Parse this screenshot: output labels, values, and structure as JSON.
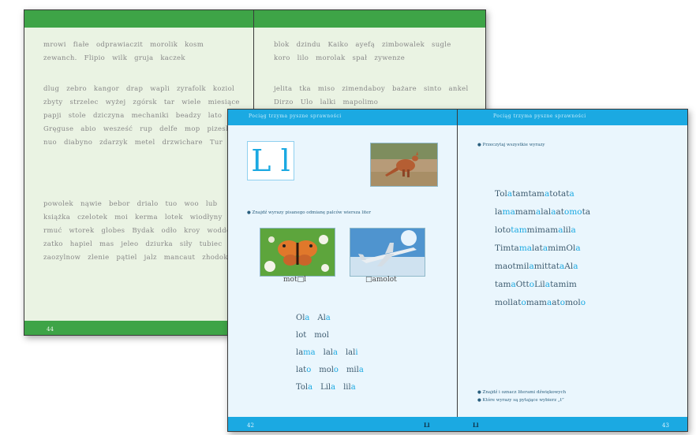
{
  "back_book": {
    "page_number": "44",
    "paragraphs_left": [
      [
        "mrowi",
        "fiałe",
        "odprawiaczit",
        "morolik",
        "kosm",
        "zewanch.",
        "Flipio",
        "wilk",
        "gruja",
        "kaczek"
      ],
      [
        "dlug",
        "zebro",
        "kangor",
        "drap",
        "wapli",
        "zyrafolk",
        "koziol",
        "zbyty",
        "strzelec",
        "wyżej",
        "zgórsk",
        "tar",
        "wiele",
        "miesiące",
        "papji",
        "stole",
        "dziczyna",
        "mechaniki",
        "beadzy",
        "lato",
        "Gręguse",
        "abio",
        "wesześć",
        "rup",
        "delfe",
        "mop",
        "pizeski",
        "nuo",
        "diabyno",
        "zdarzyk",
        "metel",
        "drzwichare",
        "Tur"
      ],
      [
        "powolek",
        "nąwie",
        "bebor",
        "drialo",
        "tuo",
        "woo",
        "lub",
        "książka",
        "czelotek",
        "moi",
        "kerma",
        "lotek",
        "wiodłyny",
        "rmuć",
        "wtorek",
        "globes",
        "Bydak",
        "odło",
        "kroy",
        "woddek",
        "zatko",
        "hapiel",
        "mas",
        "jeleo",
        "dziurka",
        "siły",
        "tubiec",
        "zaozylnow",
        "zlenie",
        "pątiel",
        "jalz",
        "mancaut",
        "zhodok"
      ]
    ],
    "paragraphs_right": [
      [
        "blok",
        "dzindu",
        "Kaiko",
        "ayefą",
        "zimbowalek",
        "sugle",
        "koro",
        "lilo",
        "morolak",
        "spał",
        "zywenze"
      ],
      [
        "jelita",
        "tka",
        "miso",
        "zimendaboy",
        "bażare",
        "sinto",
        "ankel",
        "Dirzo",
        "Ulo",
        "lalki",
        "mapolimo"
      ]
    ]
  },
  "front_book": {
    "header_text": "Pociąg trzyma pyszne sprawności",
    "letter_heading": "L l",
    "left_page_instruction": "● Znajdź wyrazy pisanego odmianę palców wiersza liter",
    "picture_captions": [
      "mot□l",
      "□amolot"
    ],
    "word_columns": [
      [
        {
          "t": "Ol",
          "h": "a"
        },
        {
          "t": "Al",
          "h": "a"
        }
      ],
      [
        {
          "t": "lot",
          "h": ""
        },
        {
          "t": "mol",
          "h": ""
        }
      ],
      [
        {
          "t": "la",
          "h": "ma"
        },
        {
          "t": "lal",
          "h": "a"
        },
        {
          "t": "lal",
          "h": "i"
        }
      ],
      [
        {
          "t": "lat",
          "h": "o"
        },
        {
          "t": "mol",
          "h": "o"
        },
        {
          "t": "mil",
          "h": "a"
        }
      ],
      [
        {
          "t": "Tol",
          "h": "a"
        },
        {
          "t": "Lil",
          "h": "a"
        },
        {
          "t": "lil",
          "h": "a"
        }
      ]
    ],
    "right_page_instruction": "● Przeczytaj wszystkie wyrazy",
    "reading_lines": [
      [
        {
          "t": "Tol",
          "h": "a"
        },
        {
          "t": "tam",
          "h": ""
        },
        {
          "t": "tam",
          "h": "a"
        },
        {
          "t": "to",
          "h": ""
        },
        {
          "t": "tat",
          "h": "a"
        }
      ],
      [
        {
          "t": "la",
          "h": "ma"
        },
        {
          "t": "mam",
          "h": "a"
        },
        {
          "t": "lal",
          "h": "a"
        },
        {
          "t": "at",
          "h": "omo"
        },
        {
          "t": "ta",
          "h": ""
        }
      ],
      [
        {
          "t": "lot",
          "h": ""
        },
        {
          "t": "o",
          "h": "tam"
        },
        {
          "t": "mi",
          "h": ""
        },
        {
          "t": "mam",
          "h": "a"
        },
        {
          "t": "lil",
          "h": "a"
        }
      ],
      [
        {
          "t": "Tim",
          "h": ""
        },
        {
          "t": "ta",
          "h": "ma"
        },
        {
          "t": "lat",
          "h": "a"
        },
        {
          "t": "mim",
          "h": ""
        },
        {
          "t": "Ol",
          "h": "a"
        }
      ],
      [
        {
          "t": "ma",
          "h": ""
        },
        {
          "t": "ot",
          "h": ""
        },
        {
          "t": "mil",
          "h": "a"
        },
        {
          "t": "mit",
          "h": ""
        },
        {
          "t": "tat",
          "h": "a"
        },
        {
          "t": "Al",
          "h": "a"
        }
      ],
      [
        {
          "t": "tam",
          "h": "a"
        },
        {
          "t": "Ott",
          "h": "o"
        },
        {
          "t": "Lil",
          "h": "a"
        },
        {
          "t": "tam",
          "h": ""
        },
        {
          "t": "im",
          "h": ""
        }
      ],
      [
        {
          "t": "mol",
          "h": ""
        },
        {
          "t": "lat",
          "h": "o"
        },
        {
          "t": "mam",
          "h": "a"
        },
        {
          "t": "at",
          "h": "o"
        },
        {
          "t": "mol",
          "h": "o"
        }
      ]
    ],
    "bottom_notes": [
      "● Znajdź i oznacz literami dźwiękowych",
      "● Które wyrazy są pytające wybierz „t”"
    ],
    "left_page_number": "42",
    "left_footer_label": "Ll",
    "right_footer_label": "Ll",
    "right_page_number": "43"
  },
  "colors": {
    "green_band": "#3ea447",
    "blue_band": "#1ba9e2",
    "highlight": "#1ba9e2"
  }
}
